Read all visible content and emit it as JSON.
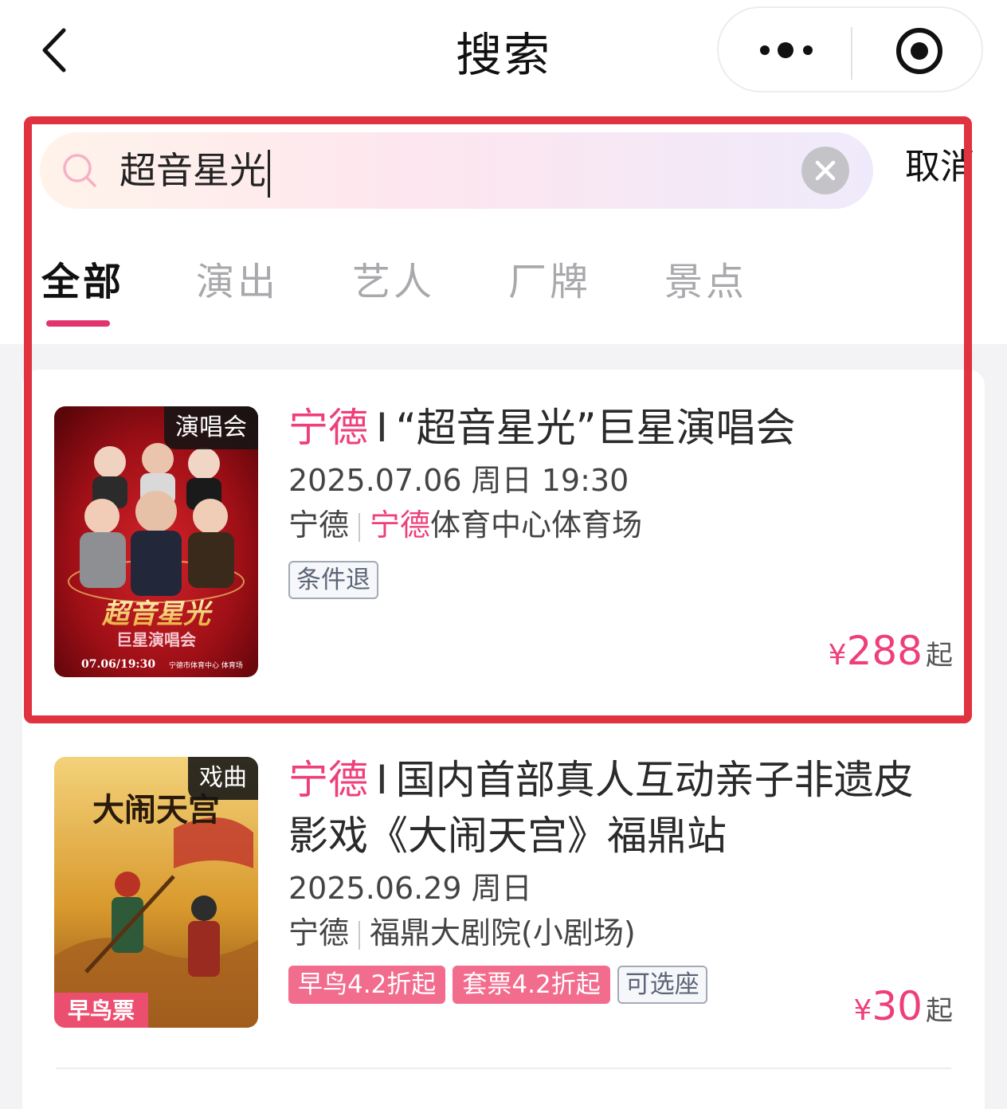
{
  "nav": {
    "title": "搜索"
  },
  "search": {
    "query": "超音星光",
    "cancel_label": "取消"
  },
  "tabs": [
    {
      "label": "全部"
    },
    {
      "label": "演出"
    },
    {
      "label": "艺人"
    },
    {
      "label": "厂牌"
    },
    {
      "label": "景点"
    }
  ],
  "results": [
    {
      "poster_tag": "演唱会",
      "city": "宁德",
      "separator": "I",
      "title": "“超音星光”巨星演唱会",
      "date": "2025.07.06 周日 19:30",
      "venue_city": "宁德",
      "venue_highlight": "宁德",
      "venue_rest": "体育中心体育场",
      "badges": [
        "条件退"
      ],
      "price_currency": "¥",
      "price": "288",
      "price_suffix": "起",
      "poster_text_main": "超音星光",
      "poster_text_sub": "巨星演唱会",
      "poster_text_foot": "07.06/19:30",
      "poster_text_venue": "宁德市体育中心 体育场"
    },
    {
      "poster_tag": "戏曲",
      "city": "宁德",
      "separator": "I",
      "title_line1": "国内首部真人互动亲子非遗皮",
      "title_line2": "影戏《大闹天宫》福鼎站",
      "date": "2025.06.29 周日",
      "venue_city": "宁德",
      "venue_name": "福鼎大剧院(小剧场)",
      "badges_pink": [
        "早鸟4.2折起",
        "套票4.2折起"
      ],
      "badges_outline": [
        "可选座"
      ],
      "price_currency": "¥",
      "price": "30",
      "price_suffix": "起",
      "poster_text_main": "大闹天宫",
      "poster_ribbon": "早鸟票"
    }
  ],
  "colors": {
    "accent": "#ee3f7a",
    "highlight_border": "#e0323f",
    "badge_pink": "#f26c8e"
  }
}
